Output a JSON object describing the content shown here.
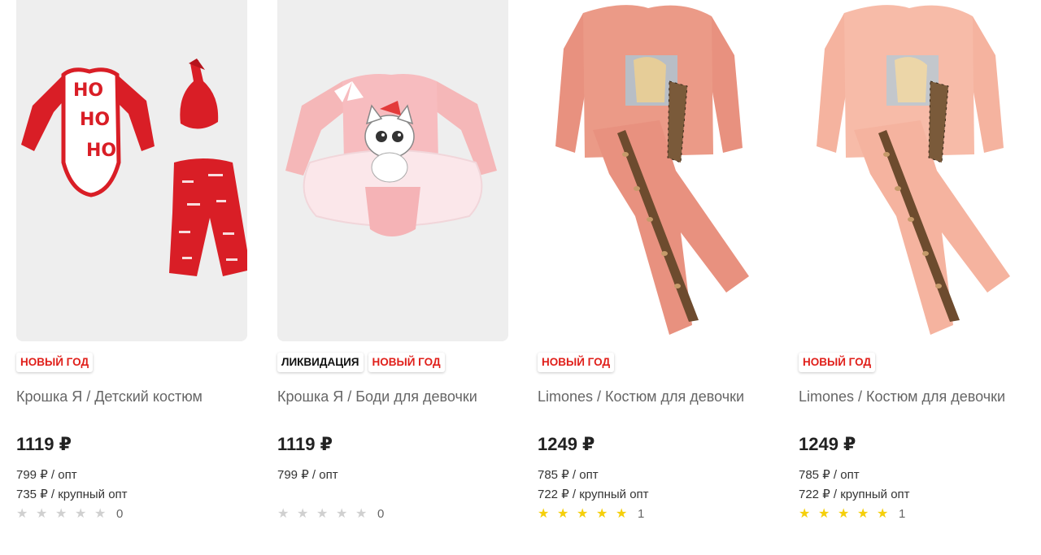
{
  "colors": {
    "badge_red": "#e0201b",
    "star_filled": "#f5cf0a",
    "star_empty": "#d0d0d0"
  },
  "products": [
    {
      "image": "baby-set-red-ho-ho-ho",
      "badges": [
        {
          "label": "НОВЫЙ ГОД",
          "kind": "new-year"
        }
      ],
      "title": "Крошка Я / Детский костюм",
      "price": "1119 ₽",
      "opt": "799 ₽ / опт",
      "bulk_opt": "735 ₽ / крупный опт",
      "rating": 0,
      "reviews": "0"
    },
    {
      "image": "pink-bodysuit-cat",
      "badges": [
        {
          "label": "ЛИКВИДАЦИЯ",
          "kind": "liquidation"
        },
        {
          "label": "НОВЫЙ ГОД",
          "kind": "new-year"
        }
      ],
      "title": "Крошка Я / Боди для девочки",
      "price": "1119 ₽",
      "opt": "799 ₽ / опт",
      "bulk_opt": "",
      "rating": 0,
      "reviews": "0"
    },
    {
      "image": "pink-tracksuit-leopard",
      "badges": [
        {
          "label": "НОВЫЙ ГОД",
          "kind": "new-year"
        }
      ],
      "title": "Limones / Костюм для девочки",
      "price": "1249 ₽",
      "opt": "785 ₽ / опт",
      "bulk_opt": "722 ₽ / крупный опт",
      "rating": 5,
      "reviews": "1"
    },
    {
      "image": "peach-tracksuit-leopard",
      "badges": [
        {
          "label": "НОВЫЙ ГОД",
          "kind": "new-year"
        }
      ],
      "title": "Limones / Костюм для девочки",
      "price": "1249 ₽",
      "opt": "785 ₽ / опт",
      "bulk_opt": "722 ₽ / крупный опт",
      "rating": 5,
      "reviews": "1"
    }
  ]
}
